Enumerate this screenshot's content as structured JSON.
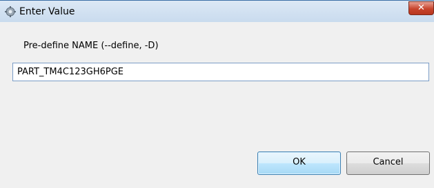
{
  "window": {
    "title": "Enter Value",
    "close_label": "✕"
  },
  "prompt": {
    "label": "Pre-define NAME (--define, -D)"
  },
  "input": {
    "value": "PART_TM4C123GH6PGE"
  },
  "buttons": {
    "ok_label": "OK",
    "cancel_label": "Cancel"
  },
  "colors": {
    "title_bar": "#c9dbee",
    "close_button": "#c7442c",
    "ok_border": "#3c7fb1"
  }
}
